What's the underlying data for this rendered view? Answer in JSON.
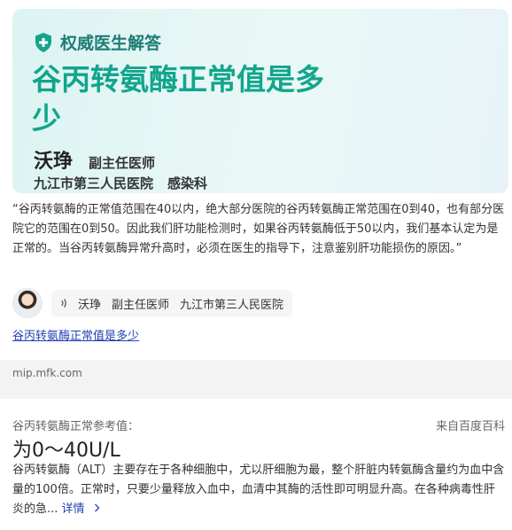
{
  "banner": {
    "badge": "权威医生解答",
    "title": "谷丙转氨酶正常值是多少",
    "doctor_name": "沃琤",
    "doctor_title": "副主任医师",
    "hospital": "九江市第三人民医院",
    "department": "感染科"
  },
  "answer": {
    "text": "“谷丙转氨酶的正常值范围在40以内，绝大部分医院的谷丙转氨酶正常范围在0到40，也有部分医院它的范围在0到50。因此我们肝功能检测时，如果谷丙转氨酶低于50以内，我们基本认定为是正常的。当谷丙转氨酶异常升高时，必须在医生的指导下，注意鉴别肝功能损伤的原因。”"
  },
  "author": {
    "name": "沃琤",
    "title": "副主任医师",
    "hospital": "九江市第三人民医院"
  },
  "question_link": "谷丙转氨酶正常值是多少",
  "source_domain": "mip.mfk.com",
  "reference": {
    "label": "谷丙转氨酶正常参考值：",
    "source": "来自百度百科",
    "value": "为0～40U/L",
    "description": "谷丙转氨酶（ALT）主要存在于各种细胞中，尤以肝细胞为最，整个肝脏内转氨酶含量约为血中含量的100倍。正常时，只要少量释放入血中，血清中其酶的活性即可明显升高。在各种病毒性肝炎的急...",
    "more_label": "详情"
  },
  "icons": {
    "shield": "shield-plus-icon",
    "audio": "audio-wave-icon",
    "chevron": "chevron-right-icon"
  },
  "colors": {
    "title_green": "#12a58c",
    "badge_green": "#1e7b74",
    "link_blue": "#2440b3"
  }
}
